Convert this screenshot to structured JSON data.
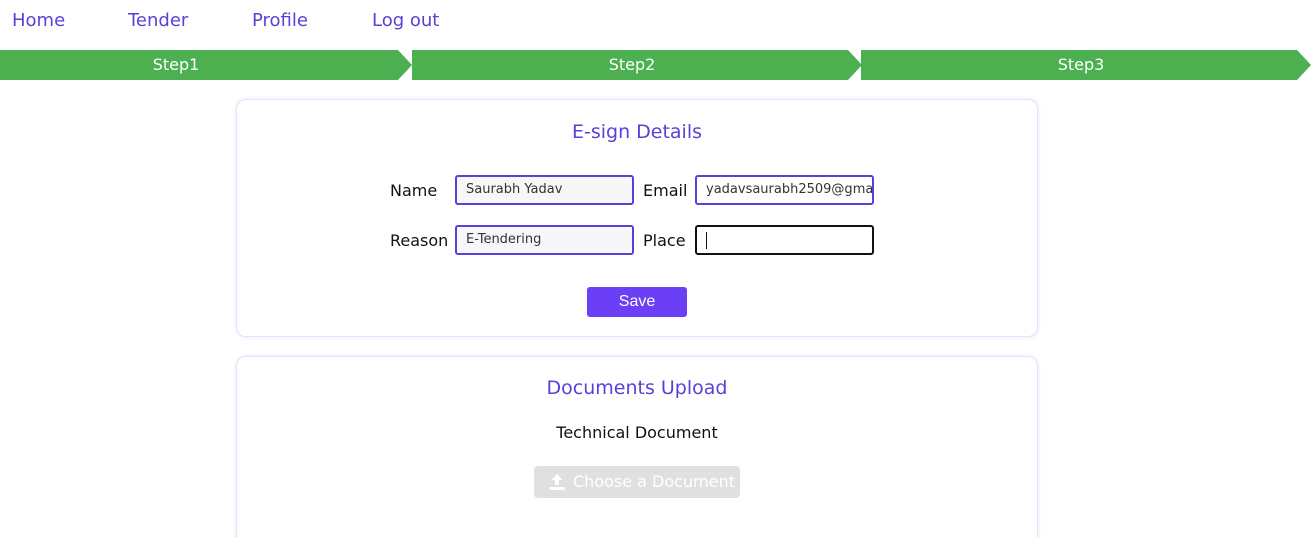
{
  "nav": {
    "home": "Home",
    "tender": "Tender",
    "profile": "Profile",
    "logout": "Log out"
  },
  "steps": [
    "Step1",
    "Step2",
    "Step3"
  ],
  "esign": {
    "title": "E-sign Details",
    "name_label": "Name",
    "name_value": "Saurabh Yadav",
    "email_label": "Email",
    "email_value": "yadavsaurabh2509@gma",
    "reason_label": "Reason",
    "reason_value": "E-Tendering",
    "place_label": "Place",
    "place_value": "",
    "save_label": "Save"
  },
  "documents": {
    "title": "Documents Upload",
    "doc_label": "Technical Document",
    "choose_label": "Choose a Document",
    "choose_icon": "upload-icon"
  },
  "colors": {
    "accent": "#5b3fd9",
    "save_button": "#6a3ff5",
    "steps_bar": "#4caf50",
    "choose_button_disabled": "#e0e0e0"
  }
}
